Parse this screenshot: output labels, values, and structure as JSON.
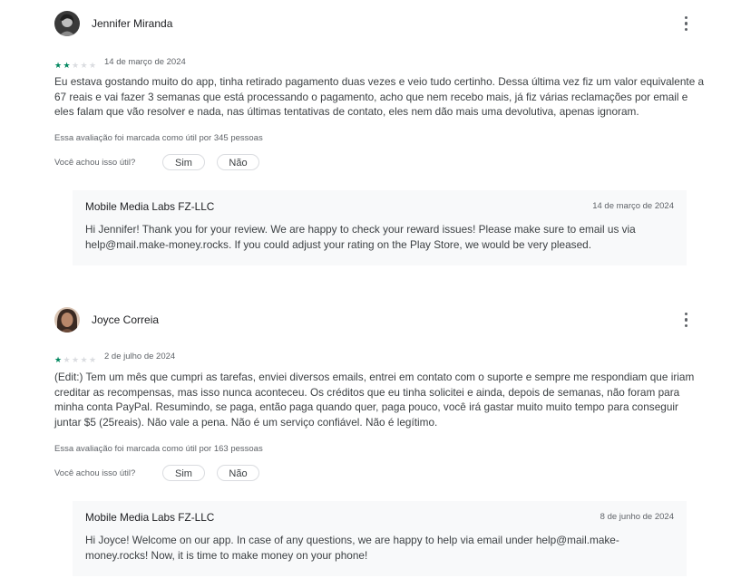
{
  "reviews": [
    {
      "author": "Jennifer Miranda",
      "avatar_icon": "user-avatar-photo",
      "rating": 2,
      "max_rating": 5,
      "date": "14 de março de 2024",
      "text": "Eu estava gostando muito do app, tinha retirado pagamento duas vezes e veio tudo certinho. Dessa última vez fiz um valor equivalente a 67 reais e vai fazer 3 semanas que está processando o pagamento, acho que nem recebo mais, já fiz várias reclamações por email e eles falam que vão resolver e nada, nas últimas tentativas de contato, eles nem dão mais uma devolutiva, apenas ignoram.",
      "helpful_count_text": "Essa avaliação foi marcada como útil por 345 pessoas",
      "helpful_question": "Você achou isso útil?",
      "yes_label": "Sim",
      "no_label": "Não",
      "reply": {
        "author": "Mobile Media Labs FZ-LLC",
        "date": "14 de março de 2024",
        "text": "Hi Jennifer! Thank you for your review. We are happy to check your reward issues! Please make sure to email us via help@mail.make-money.rocks. If you could adjust your rating on the Play Store, we would be very pleased."
      }
    },
    {
      "author": "Joyce Correia",
      "avatar_icon": "user-avatar-photo",
      "rating": 1,
      "max_rating": 5,
      "date": "2 de julho de 2024",
      "text": "(Edit:) Tem um mês que cumpri as tarefas, enviei diversos emails, entrei em contato com o suporte e sempre me respondiam que iriam creditar as recompensas, mas isso nunca aconteceu. Os créditos que eu tinha solicitei e ainda, depois de semanas, não foram para minha conta PayPal. Resumindo, se paga, então paga quando quer, paga pouco, você irá gastar muito muito tempo para conseguir juntar $5 (25reais). Não vale a pena. Não é um serviço confiável. Não é legítimo.",
      "helpful_count_text": "Essa avaliação foi marcada como útil por 163 pessoas",
      "helpful_question": "Você achou isso útil?",
      "yes_label": "Sim",
      "no_label": "Não",
      "reply": {
        "author": "Mobile Media Labs FZ-LLC",
        "date": "8 de junho de 2024",
        "text": "Hi Joyce! Welcome on our app. In case of any questions, we are happy to help via email under help@mail.make-money.rocks! Now, it is time to make money on your phone!"
      }
    }
  ],
  "icons": {
    "more": "more-vert-icon",
    "star_filled": "star-filled-icon",
    "star_empty": "star-empty-icon"
  },
  "colors": {
    "star_accent": "#01875f",
    "star_empty": "#dadce0",
    "reply_background": "#f8f9fa"
  }
}
